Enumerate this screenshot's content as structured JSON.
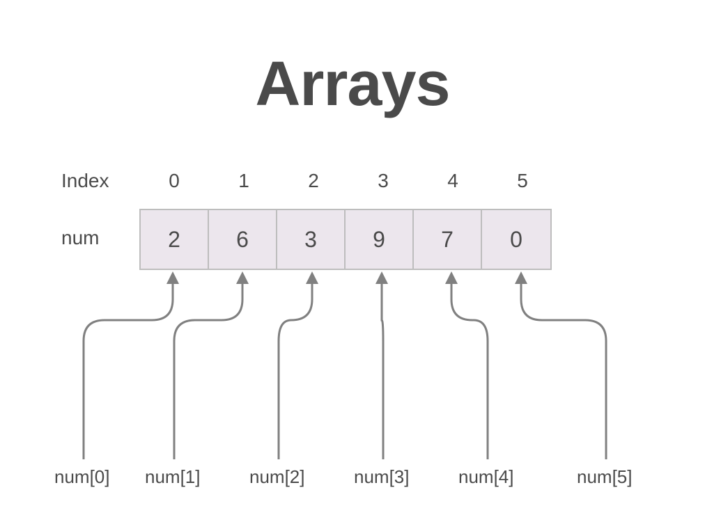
{
  "title": "Arrays",
  "labels": {
    "index": "Index",
    "array_name": "num"
  },
  "indices": [
    "0",
    "1",
    "2",
    "3",
    "4",
    "5"
  ],
  "values": [
    "2",
    "6",
    "3",
    "9",
    "7",
    "0"
  ],
  "references": [
    "num[0]",
    "num[1]",
    "num[2]",
    "num[3]",
    "num[4]",
    "num[5]"
  ]
}
